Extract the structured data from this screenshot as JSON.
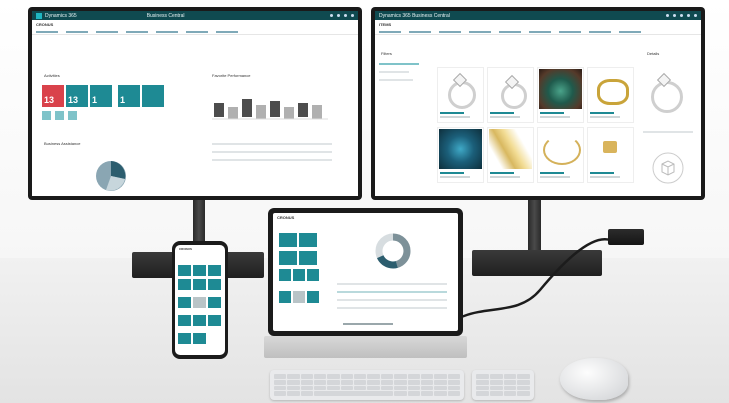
{
  "left_monitor": {
    "app_title": "Dynamics 365",
    "center_title": "Business Central",
    "company": "CRONUS",
    "kpi_values": [
      "13",
      "13",
      "1",
      "1"
    ],
    "section_headers": [
      "Activities",
      "Favorite Performance",
      "Business Assistance"
    ]
  },
  "right_monitor": {
    "app_title": "Dynamics 365 Business Central",
    "page_title": "ITEMS",
    "filter_label": "Filters",
    "side_panel_title": "Details"
  },
  "tablet": {
    "page_title": "CRONUS"
  },
  "phone": {
    "page_title": "CRONUS"
  },
  "colors": {
    "accent": "#1e8a94",
    "header": "#0f4a50",
    "alert": "#d9424b",
    "device_frame": "#1a1a1a"
  },
  "icons": [
    "logo-icon",
    "ring-icon",
    "gem-icon",
    "mouse-icon",
    "dock-icon"
  ]
}
